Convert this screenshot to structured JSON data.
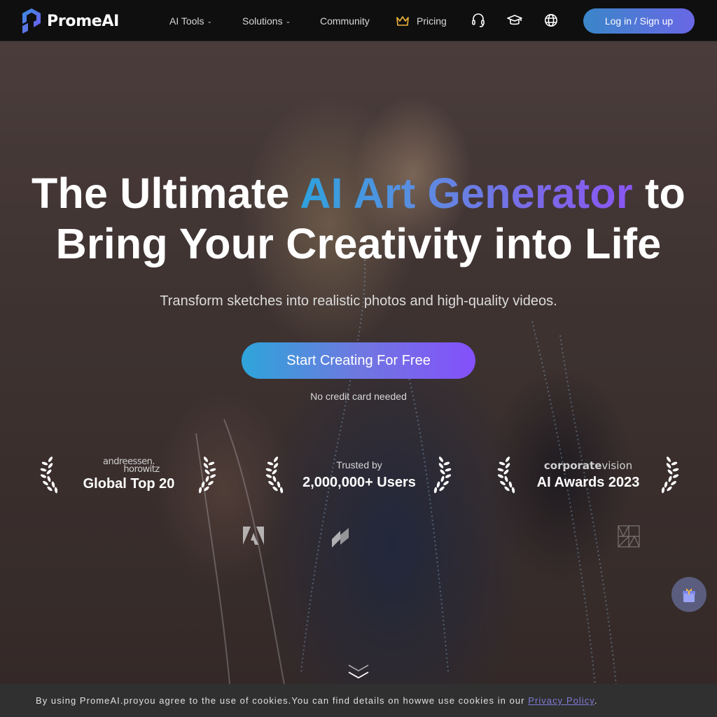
{
  "navbar": {
    "brand": "PromeAI",
    "items": [
      {
        "label": "AI Tools",
        "has_dropdown": true
      },
      {
        "label": "Solutions",
        "has_dropdown": true
      },
      {
        "label": "Community",
        "has_dropdown": false
      },
      {
        "label": "Pricing",
        "icon": "crown-icon"
      }
    ],
    "icons": [
      "headset-icon",
      "graduation-cap-icon",
      "globe-icon"
    ],
    "login_label": "Log in / Sign up",
    "colors": {
      "pricing_icon": "#f0b43c",
      "login_gradient_start": "#3a86c8",
      "login_gradient_end": "#6a67e6"
    }
  },
  "hero": {
    "title_part1": "The Ultimate ",
    "title_highlight": "AI Art Generator",
    "title_part2": " to",
    "title_line2": "Bring Your Creativity into Life",
    "subtitle": "Transform sketches into realistic photos and high-quality videos.",
    "cta_label": "Start Creating For Free",
    "cta_note": "No credit card needed",
    "colors": {
      "highlight_start": "#2ea2de",
      "highlight_end": "#8a56f3"
    }
  },
  "awards": [
    {
      "logo_line1": "andreessen.",
      "logo_line2": "horowitz",
      "title": "Global Top 20"
    },
    {
      "caption": "Trusted by",
      "title": "2,000,000+ Users"
    },
    {
      "logo_bold": "corporate",
      "logo_light": "vision",
      "title": "AI Awards 2023"
    }
  ],
  "brand_logos": [
    "adobe-logo",
    "brand-logo-2",
    "brand-logo-3"
  ],
  "floating": {
    "gift_icon": "gift-icon"
  },
  "cookie": {
    "text": "By using PromeAI.proyou agree to the use of cookies.You can find details on howwe use cookies in our ",
    "link": "Privacy Policy",
    "end": "."
  }
}
